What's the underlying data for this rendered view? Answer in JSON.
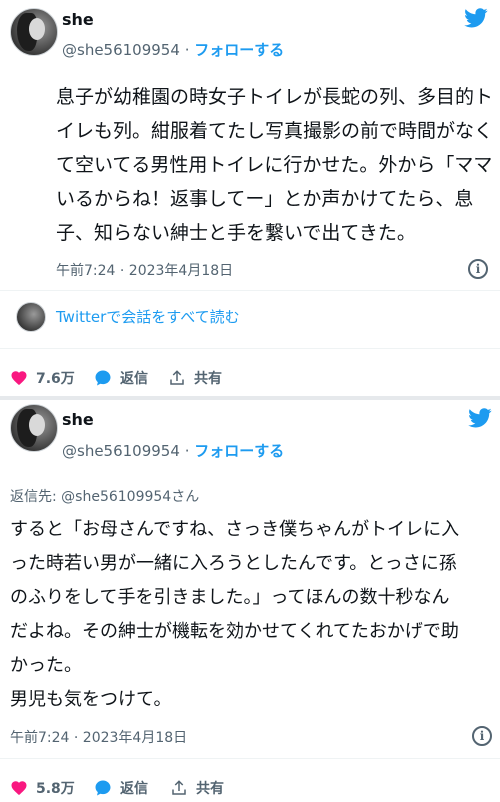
{
  "colors": {
    "accent": "#1d9bf0",
    "like": "#f91880",
    "text": "#0f1419",
    "muted": "#536471"
  },
  "tweet1": {
    "name": "she",
    "handle": "@she56109954",
    "sep": "·",
    "follow_label": "フォローする",
    "text_lines": [
      "息子が幼稚園の時女子トイレが長蛇の列、多目的ト",
      "イレも列。紺服着てたし写真撮影の前で時間がなく",
      "て空いてる男性用トイレに行かせた。外から「ママ",
      "いるからね！返事してー」とか声かけてたら、息",
      "子、知らない紳士と手を繋いで出てきた。"
    ],
    "timestamp": "午前7:24 · 2023年4月18日",
    "conversation_link": "Twitterで会話をすべて読む",
    "likes": "7.6万",
    "reply_label": "返信",
    "share_label": "共有"
  },
  "tweet2": {
    "name": "she",
    "handle": "@she56109954",
    "sep": "·",
    "follow_label": "フォローする",
    "reply_to": "返信先: @she56109954さん",
    "text_lines": [
      "すると「お母さんですね、さっき僕ちゃんがトイレに入",
      "った時若い男が一緒に入ろうとしたんです。とっさに孫",
      "のふりをして手を引きました。」ってほんの数十秒なん",
      "だよね。その紳士が機転を効かせてくれてたおかげで助",
      "かった。",
      "男児も気をつけて。"
    ],
    "timestamp": "午前7:24 · 2023年4月18日",
    "likes": "5.8万",
    "reply_label": "返信",
    "share_label": "共有"
  },
  "icons": [
    "twitter-bird-icon",
    "info-icon",
    "heart-icon",
    "reply-bubble-icon",
    "share-icon"
  ]
}
